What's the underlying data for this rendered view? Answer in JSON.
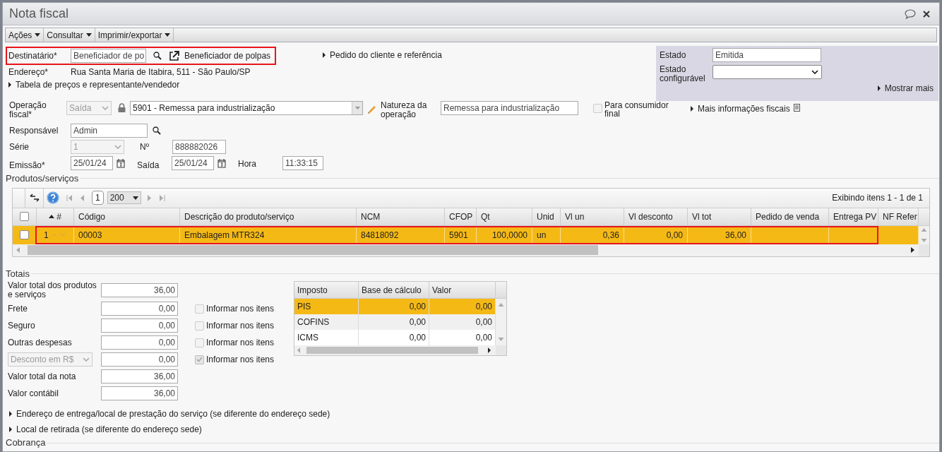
{
  "window": {
    "title": "Nota fiscal"
  },
  "menu": [
    {
      "label": "Ações"
    },
    {
      "label": "Consultar"
    },
    {
      "label": "Imprimir/exportar"
    }
  ],
  "recipient": {
    "label": "Destinatário*",
    "value": "Beneficiador de po",
    "link": "Beneficiador de polpas",
    "highlighted": true
  },
  "address": {
    "label": "Endereço*",
    "value": "Rua Santa Maria de Itabira, 511 - São Paulo/SP"
  },
  "expanders_top": [
    {
      "label": "Tabela de preços e representante/vendedor"
    },
    {
      "label": "Pedido do cliente e referência"
    }
  ],
  "status_panel": {
    "state_label": "Estado",
    "state_value": "Emitida",
    "config_label": "Estado configurável",
    "more": "Mostrar mais"
  },
  "operation": {
    "label": "Operação fiscal*",
    "direction": {
      "value": "Saída",
      "disabled": true
    },
    "cfop": {
      "value": "5901 - Remessa para industrialização",
      "disabled": false
    },
    "nature_label": "Natureza da operação",
    "nature_value": "Remessa para industrialização",
    "consumer": {
      "label": "Para consumidor final",
      "checked": false
    },
    "more_fiscal": "Mais informações fiscais"
  },
  "responsible": {
    "label": "Responsável",
    "value": "Admin"
  },
  "series": {
    "label": "Série",
    "value": "1",
    "disabled": true,
    "number_label": "Nº",
    "number_value": "888882026"
  },
  "dates": {
    "issue_label": "Emissão*",
    "issue_value": "25/01/24",
    "exit_label": "Saída",
    "exit_value": "25/01/24",
    "time_label": "Hora",
    "time_value": "11:33:15"
  },
  "products": {
    "title": "Produtos/serviços",
    "all_checked": false,
    "page": "1",
    "page_size": "200",
    "info": "Exibindo itens 1 - 1 de 1",
    "columns": [
      "#",
      "Código",
      "Descrição do produto/serviço",
      "NCM",
      "CFOP",
      "Qt",
      "Unid",
      "Vl un",
      "Vl desconto",
      "Vl tot",
      "Pedido de venda",
      "Entrega PV",
      "NF Refer"
    ],
    "rows": [
      {
        "selected": true,
        "checked": false,
        "highlighted": true,
        "cells": [
          "1",
          "00003",
          "Embalagem MTR324",
          "84818092",
          "5901",
          "100,0000",
          "un",
          "0,36",
          "0,00",
          "36,00"
        ]
      }
    ]
  },
  "totals": {
    "title": "Totais",
    "fields": [
      {
        "kind": "text",
        "label": "Valor total dos produtos e serviços",
        "value": "36,00"
      },
      {
        "kind": "text",
        "label": "Frete",
        "value": "0,00",
        "inform": {
          "label": "Informar nos itens",
          "checked": false
        }
      },
      {
        "kind": "text",
        "label": "Seguro",
        "value": "0,00",
        "inform": {
          "label": "Informar nos itens",
          "checked": false
        }
      },
      {
        "kind": "text",
        "label": "Outras despesas",
        "value": "0,00",
        "inform": {
          "label": "Informar nos itens",
          "checked": false
        }
      },
      {
        "kind": "select",
        "label": "Desconto em R$",
        "value": "0,00",
        "inform": {
          "label": "Informar nos itens",
          "checked": true
        }
      },
      {
        "kind": "text",
        "label": "Valor total da nota",
        "value": "36,00"
      },
      {
        "kind": "text",
        "label": "Valor contábil",
        "value": "36,00"
      }
    ]
  },
  "taxes": {
    "columns": [
      "Imposto",
      "Base de cálculo",
      "Valor"
    ],
    "rows": [
      {
        "selected": true,
        "cells": [
          "PIS",
          "0,00",
          "0,00"
        ]
      },
      {
        "selected": false,
        "cells": [
          "COFINS",
          "0,00",
          "0,00"
        ]
      },
      {
        "selected": false,
        "cells": [
          "ICMS",
          "0,00",
          "0,00"
        ]
      }
    ]
  },
  "expanders_bottom": [
    {
      "label": "Endereço de entrega/local de prestação do serviço (se diferente do endereço sede)"
    },
    {
      "label": "Local de retirada (se diferente do endereço sede)"
    }
  ],
  "next_section": {
    "title": "Cobrança"
  }
}
